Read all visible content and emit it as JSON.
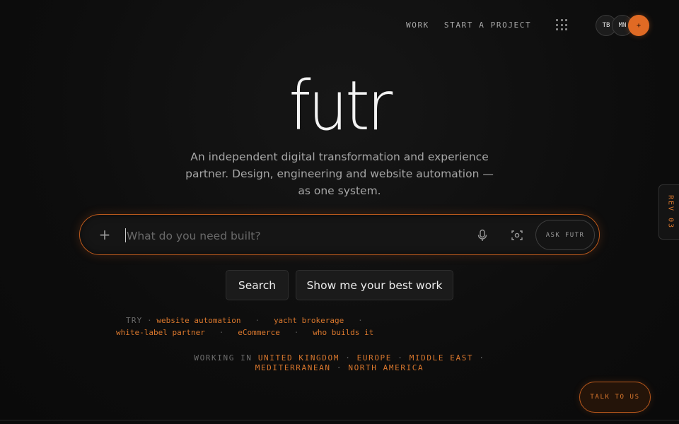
{
  "header": {
    "nav": [
      {
        "label": "WORK"
      },
      {
        "label": "START A PROJECT"
      }
    ],
    "grid_icon": "grid-dots-icon",
    "avatars": [
      "TB",
      "MN"
    ],
    "add_avatar_label": "+"
  },
  "hero": {
    "logo": "futr",
    "tagline": "An independent digital transformation and experience partner. Design, engineering and website automation — as one system."
  },
  "search": {
    "plus_label": "+",
    "placeholder": "What do you need built?",
    "value": "",
    "mic_icon": "microphone-icon",
    "scan_icon": "camera-scan-icon",
    "ask_label": "ASK FUTR"
  },
  "chips": [
    {
      "label": "Search"
    },
    {
      "label": "Show me your best work"
    }
  ],
  "try": {
    "label": "TRY",
    "suggestions": [
      "website automation",
      "yacht brokerage",
      "white-label partner",
      "eCommerce",
      "who builds it"
    ],
    "separator": "·"
  },
  "working_in": {
    "label": "WORKING IN",
    "locations": [
      "UNITED KINGDOM",
      "EUROPE",
      "MIDDLE EAST",
      "MEDITERRANEAN",
      "NORTH AMERICA"
    ],
    "separator": "·"
  },
  "rev_tab": "REV 03",
  "talk_button": "TALK TO US",
  "colors": {
    "accent": "#e06a24",
    "accent_text": "#d9772d",
    "background": "#0d0d0d"
  }
}
